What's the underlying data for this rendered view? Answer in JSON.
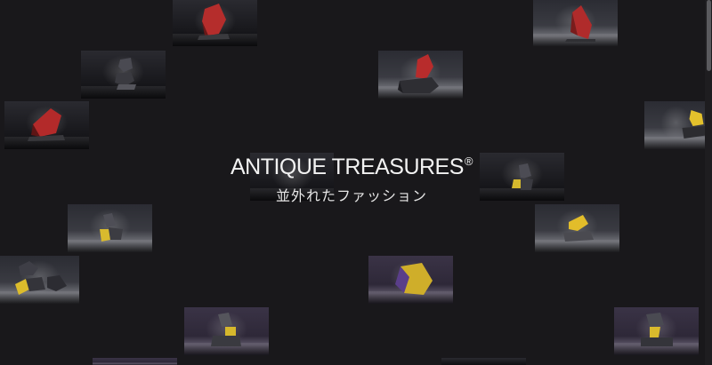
{
  "hero": {
    "title": "ANTIQUE TREASURES",
    "registered_mark": "®",
    "subtitle": "並外れたファッション"
  },
  "gallery": {
    "tiles": [
      {
        "name": "tile-red-stone-top",
        "style": "dark",
        "stone": "red"
      },
      {
        "name": "tile-red-stone-topright",
        "style": "light",
        "stone": "red"
      },
      {
        "name": "tile-stacked-stone-1",
        "style": "dark",
        "stone": "gray"
      },
      {
        "name": "tile-red-stone-center",
        "style": "dark",
        "stone": "red"
      },
      {
        "name": "tile-red-stone-left",
        "style": "dark",
        "stone": "red"
      },
      {
        "name": "tile-yellow-stone-right",
        "style": "light",
        "stone": "yellow"
      },
      {
        "name": "tile-stacked-stone-2",
        "style": "dark",
        "stone": "gray"
      },
      {
        "name": "tile-stacked-stone-3",
        "style": "dark",
        "stone": "gray-yellow"
      },
      {
        "name": "tile-yellow-stone-mid",
        "style": "light",
        "stone": "yellow"
      },
      {
        "name": "tile-stacked-stone-4",
        "style": "light",
        "stone": "gray-yellow"
      },
      {
        "name": "tile-stone-left-low",
        "style": "light",
        "stone": "gray-yellow"
      },
      {
        "name": "tile-purple-stone",
        "style": "purple",
        "stone": "purple-yellow"
      },
      {
        "name": "tile-stacked-stone-5",
        "style": "dark",
        "stone": "gray-yellow"
      },
      {
        "name": "tile-purple-stone-right",
        "style": "purple",
        "stone": "gray-yellow"
      }
    ]
  },
  "colors": {
    "background": "#19181b",
    "title_text": "#f2f2f2",
    "accent_red": "#b32a2a",
    "accent_yellow": "#e3bf2a"
  }
}
